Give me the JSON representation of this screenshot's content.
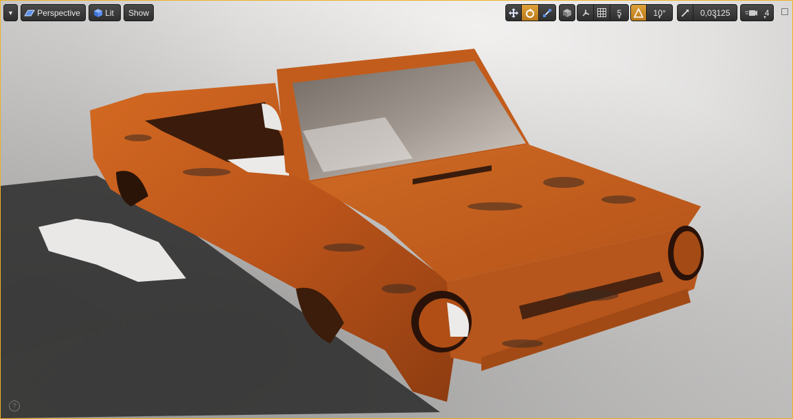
{
  "toolbar_left": {
    "menu_caret": "▼",
    "perspective_label": "Perspective",
    "lit_label": "Lit",
    "show_label": "Show"
  },
  "toolbar_right": {
    "grid_snap_value": "5",
    "rotation_snap_value": "10°",
    "scale_snap_value": "0,03125",
    "camera_speed_value": "4"
  },
  "icons": {
    "translate": "translate-icon",
    "rotate": "rotate-icon",
    "scale": "scale-icon",
    "surface": "surface-snap-icon",
    "world": "world-local-icon",
    "grid": "grid-snap-icon",
    "angle": "angle-snap-icon",
    "scale_snap": "scale-snap-icon",
    "camera": "camera-speed-icon",
    "help": "help-icon",
    "maximize": "maximize-icon"
  },
  "help_text": "?",
  "colors": {
    "viewport_border": "#f0b020",
    "active_button": "#d0902a",
    "toolbar_button": "#3a3a3a",
    "car_paint": "#c65a16"
  }
}
